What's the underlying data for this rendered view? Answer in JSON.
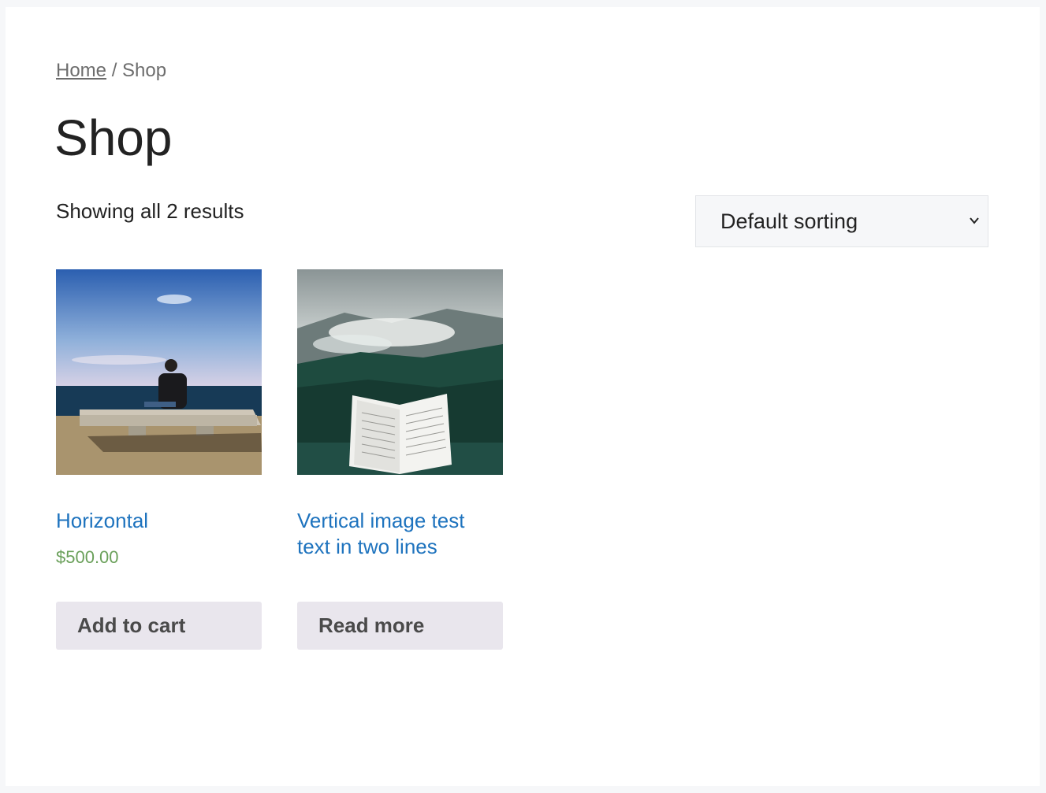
{
  "breadcrumb": {
    "home": "Home",
    "separator": " / ",
    "current": "Shop"
  },
  "page_title": "Shop",
  "result_count": "Showing all 2 results",
  "sorting": {
    "selected": "Default sorting"
  },
  "products": [
    {
      "title": "Horizontal",
      "price": "$500.00",
      "button_label": "Add to cart",
      "image": "person-on-bench-by-sea"
    },
    {
      "title": "Vertical image test text in two lines",
      "price": "",
      "button_label": "Read more",
      "image": "open-book-misty-forest"
    }
  ],
  "colors": {
    "link": "#1e73be",
    "price": "#6aa05a",
    "button_bg": "#e9e6ed",
    "page_bg": "#f6f7f9"
  }
}
